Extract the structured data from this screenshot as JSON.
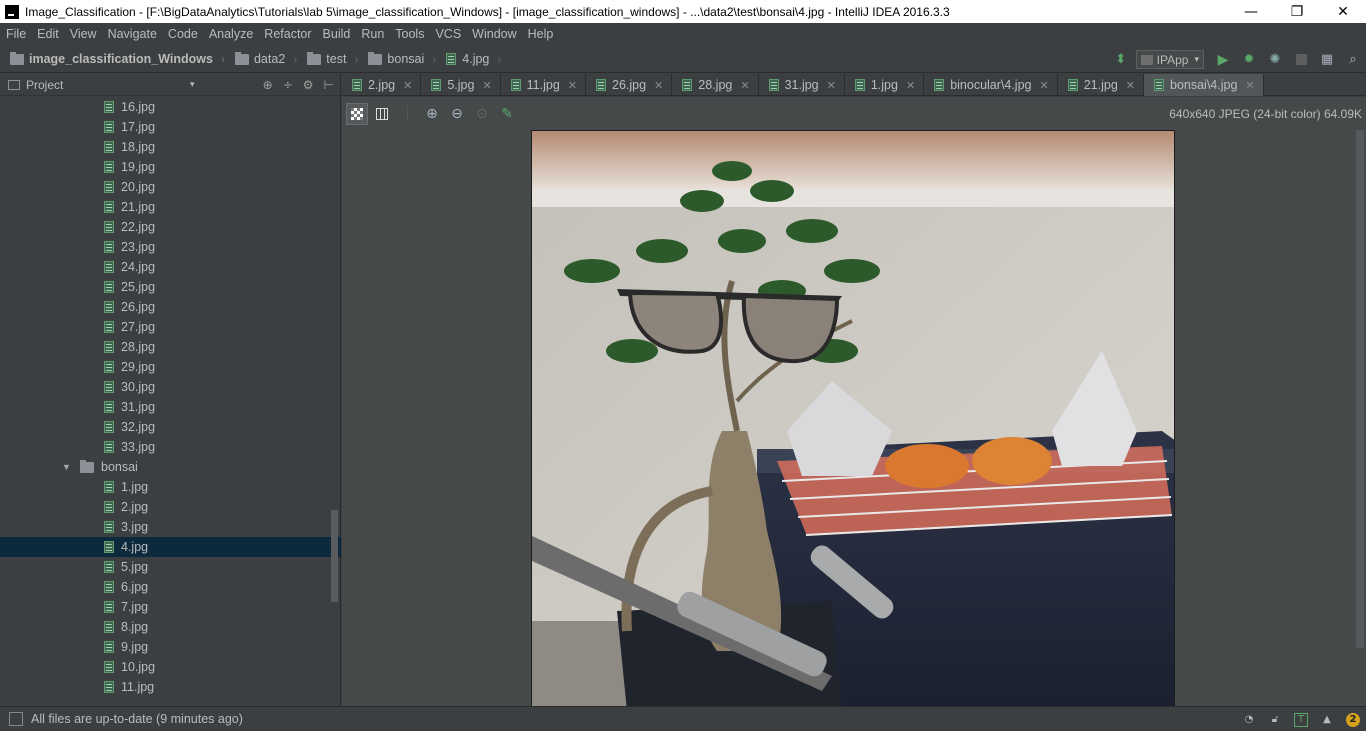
{
  "window": {
    "title": "Image_Classification - [F:\\BigDataAnalytics\\Tutorials\\lab 5\\image_classification_Windows] - [image_classification_windows] - ...\\data2\\test\\bonsai\\4.jpg - IntelliJ IDEA 2016.3.3",
    "minimize": "—",
    "restore": "❐",
    "close": "✕"
  },
  "menu": [
    "File",
    "Edit",
    "View",
    "Navigate",
    "Code",
    "Analyze",
    "Refactor",
    "Build",
    "Run",
    "Tools",
    "VCS",
    "Window",
    "Help"
  ],
  "breadcrumbs": [
    "image_classification_Windows",
    "data2",
    "test",
    "bonsai",
    "4.jpg"
  ],
  "runbar": {
    "config_name": "IPApp",
    "caret": "▾"
  },
  "project_panel": {
    "label": "Project",
    "caret": "▾",
    "tools": [
      "⊕",
      "÷",
      "⚙",
      "⊢"
    ]
  },
  "tree": {
    "items_top": [
      "16.jpg",
      "17.jpg",
      "18.jpg",
      "19.jpg",
      "20.jpg",
      "21.jpg",
      "22.jpg",
      "23.jpg",
      "24.jpg",
      "25.jpg",
      "26.jpg",
      "27.jpg",
      "28.jpg",
      "29.jpg",
      "30.jpg",
      "31.jpg",
      "32.jpg",
      "33.jpg"
    ],
    "folder": "bonsai",
    "items_bonsai": [
      "1.jpg",
      "2.jpg",
      "3.jpg",
      "4.jpg",
      "5.jpg",
      "6.jpg",
      "7.jpg",
      "8.jpg",
      "9.jpg",
      "10.jpg",
      "11.jpg"
    ],
    "selected": "4.jpg"
  },
  "tabs": [
    "2.jpg",
    "5.jpg",
    "11.jpg",
    "26.jpg",
    "28.jpg",
    "31.jpg",
    "1.jpg",
    "binocular\\4.jpg",
    "21.jpg",
    "bonsai\\4.jpg"
  ],
  "active_tab": "bonsai\\4.jpg",
  "image_info": "640x640 JPEG (24-bit color) 64.09K",
  "status": {
    "text": "All files are up-to-date (9 minutes ago)",
    "badge": "2"
  },
  "colors": {
    "ide_background": "#3c3f41",
    "selection": "#0d293e",
    "editor_background": "#45494a",
    "run_green": "#59a869"
  }
}
